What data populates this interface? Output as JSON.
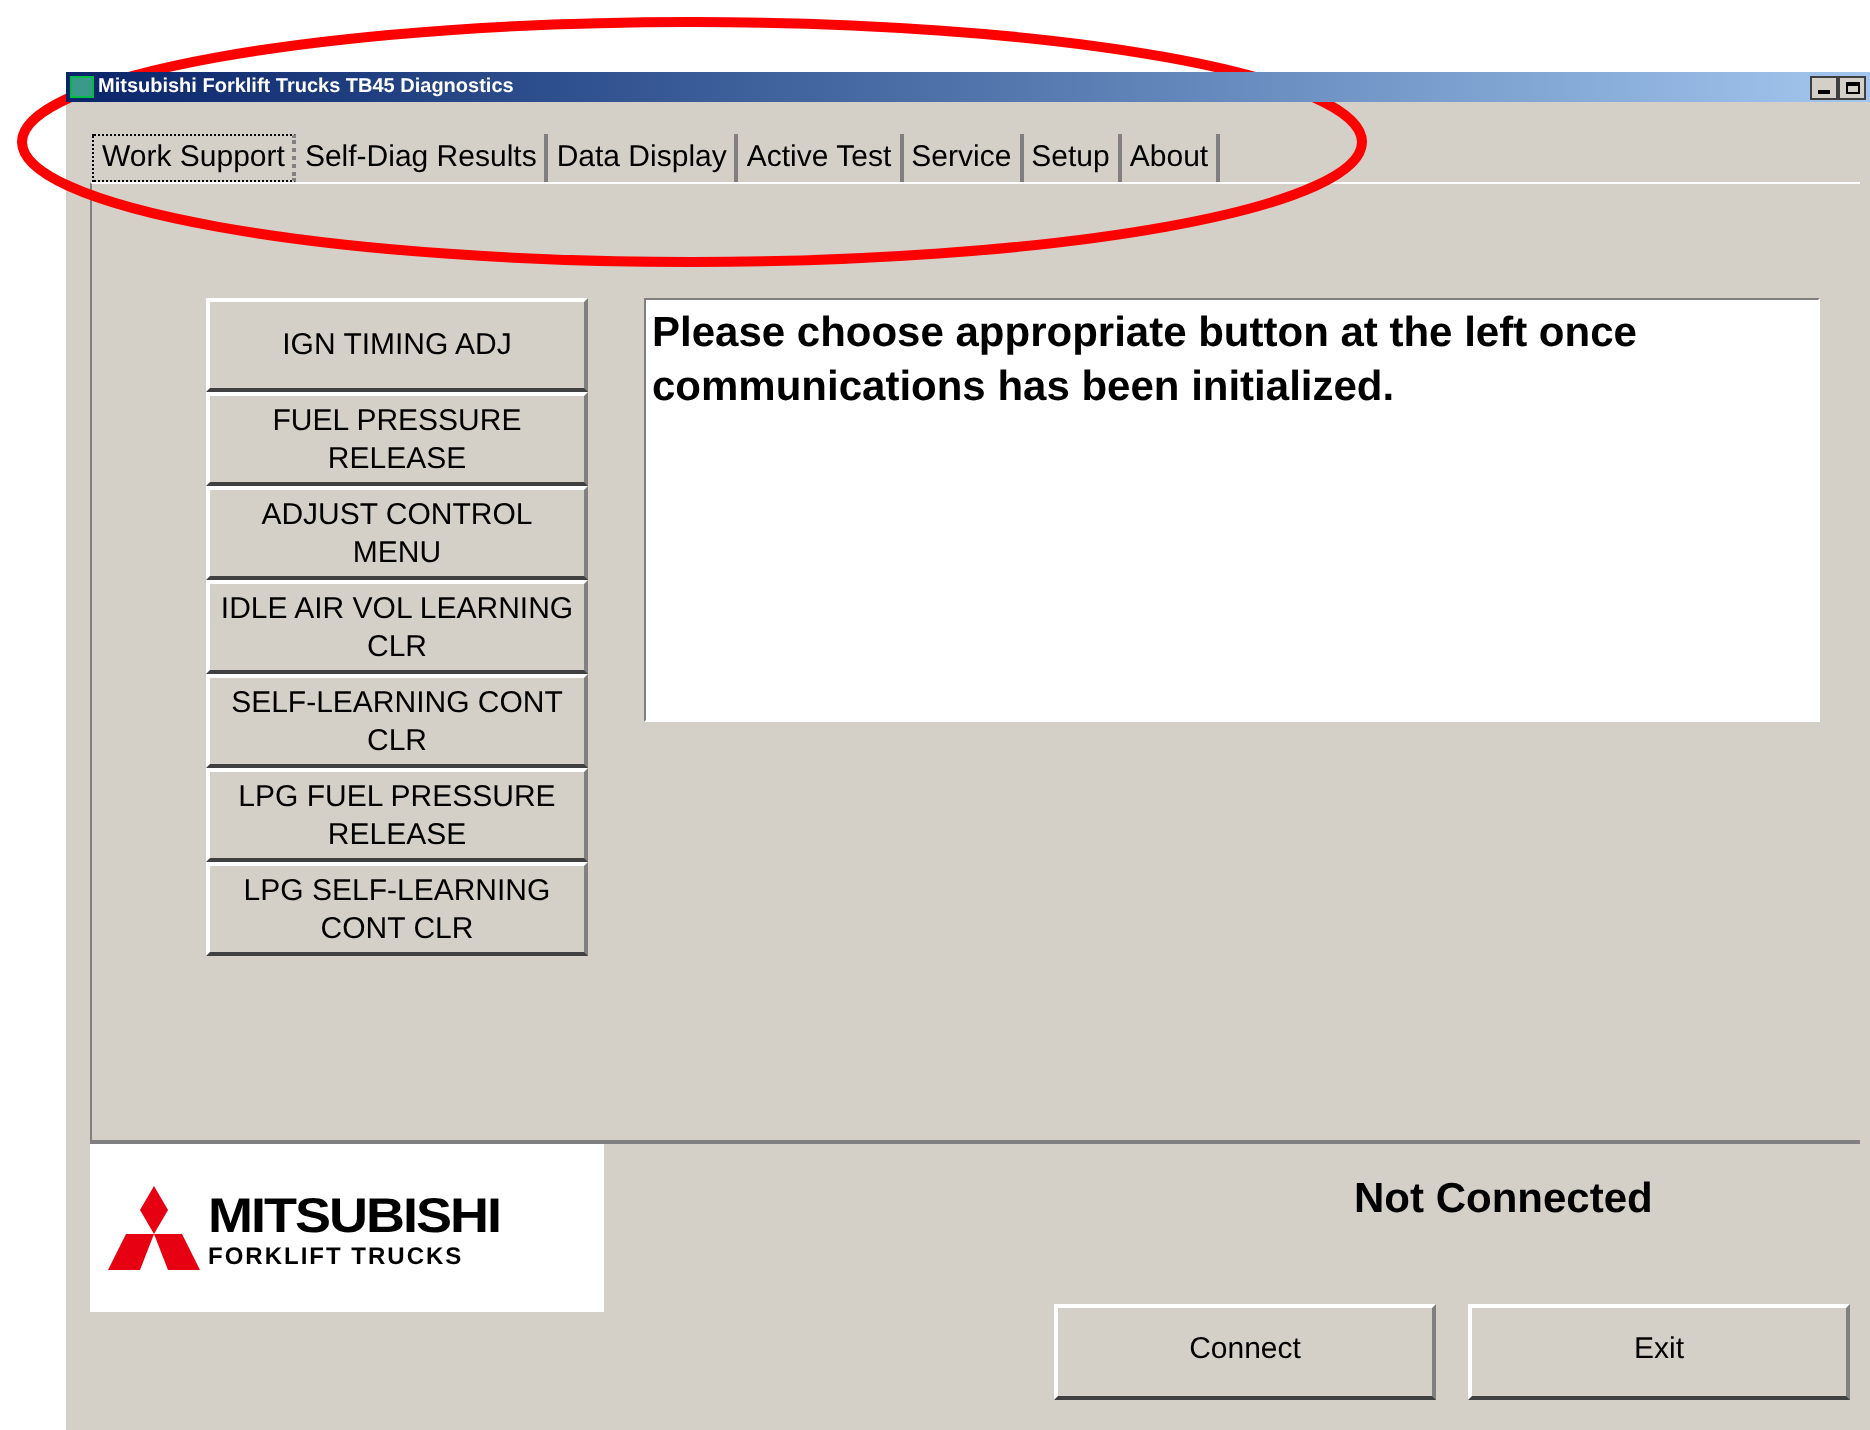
{
  "window": {
    "title": "Mitsubishi Forklift Trucks TB45 Diagnostics"
  },
  "tabs": [
    {
      "label": "Work Support",
      "selected": true
    },
    {
      "label": "Self-Diag Results",
      "selected": false
    },
    {
      "label": "Data Display",
      "selected": false
    },
    {
      "label": "Active Test",
      "selected": false
    },
    {
      "label": "Service",
      "selected": false
    },
    {
      "label": "Setup",
      "selected": false
    },
    {
      "label": "About",
      "selected": false
    }
  ],
  "work_buttons": [
    "IGN TIMING ADJ",
    "FUEL PRESSURE RELEASE",
    "ADJUST CONTROL MENU",
    "IDLE AIR VOL LEARNING CLR",
    "SELF-LEARNING CONT CLR",
    "LPG FUEL PRESSURE RELEASE",
    "LPG SELF-LEARNING CONT CLR"
  ],
  "message": "Please choose appropriate button at the left once communications has been initialized.",
  "logo": {
    "name": "MITSUBISHI",
    "subtitle": "FORKLIFT TRUCKS"
  },
  "status": "Not Connected",
  "buttons": [
    "Connect",
    "Exit"
  ]
}
